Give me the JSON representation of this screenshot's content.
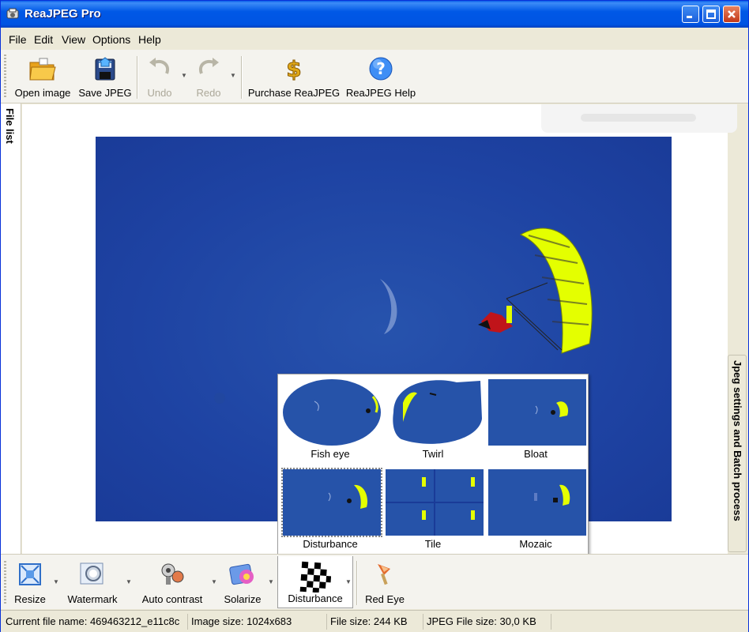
{
  "window": {
    "title": "ReaJPEG Pro"
  },
  "menu": {
    "items": [
      "File",
      "Edit",
      "View",
      "Options",
      "Help"
    ]
  },
  "toolbar": {
    "open_label": "Open image",
    "save_label": "Save JPEG",
    "undo_label": "Undo",
    "redo_label": "Redo",
    "purchase_label": "Purchase ReaJPEG",
    "help_label": "ReaJPEG Help"
  },
  "panels": {
    "file_list": "File list",
    "jpeg_settings": "Jpeg settings and Batch process"
  },
  "effects_popup": {
    "items": [
      "Fish eye",
      "Twirl",
      "Bloat",
      "Disturbance",
      "Tile",
      "Mozaic"
    ]
  },
  "effects_bar": {
    "resize": "Resize",
    "watermark": "Watermark",
    "auto_contrast": "Auto contrast",
    "solarize": "Solarize",
    "disturbance": "Disturbance",
    "red_eye": "Red Eye"
  },
  "status": {
    "file_name_label": "Current file name:",
    "file_name": "469463212_e11c8c",
    "image_size_label": "Image size:",
    "image_size": "1024x683",
    "file_size_label": "File size:",
    "file_size": "244 KB",
    "jpeg_size_label": "JPEG File size:",
    "jpeg_size": "30,0 KB"
  },
  "colors": {
    "titlebar": "#0054e3",
    "sky": "#1e43a3",
    "canopy": "#e4ff00"
  }
}
